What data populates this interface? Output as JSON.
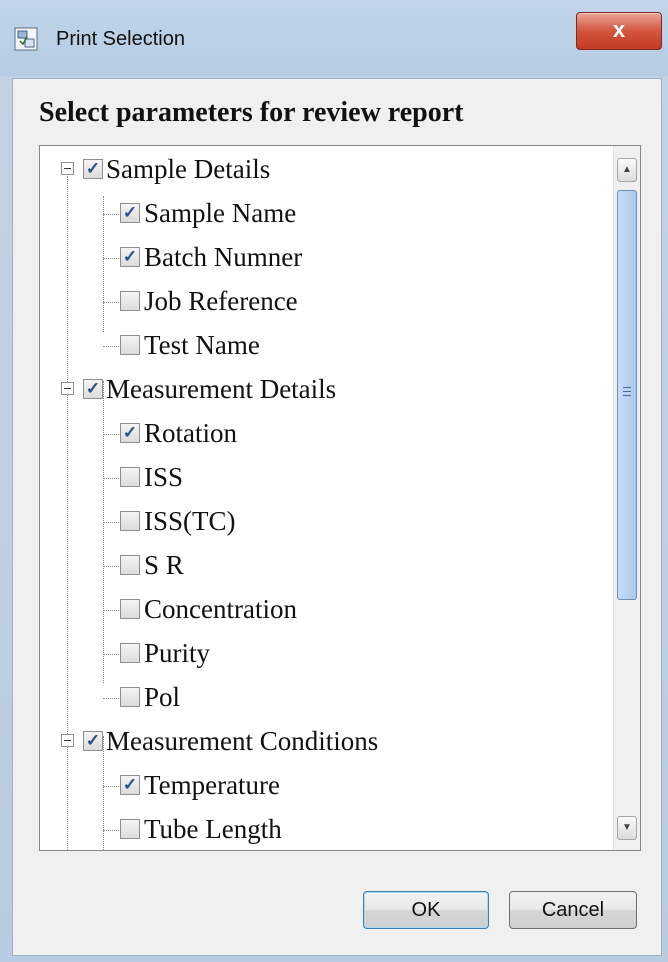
{
  "window": {
    "title": "Print Selection",
    "close_label": "x"
  },
  "dialog": {
    "heading": "Select parameters for review report"
  },
  "tree": {
    "groups": [
      {
        "label": "Sample Details",
        "checked": true,
        "items": [
          {
            "label": "Sample Name",
            "checked": true
          },
          {
            "label": "Batch Numner",
            "checked": true
          },
          {
            "label": "Job Reference",
            "checked": false
          },
          {
            "label": "Test Name",
            "checked": false
          }
        ]
      },
      {
        "label": "Measurement Details",
        "checked": true,
        "items": [
          {
            "label": "Rotation",
            "checked": true
          },
          {
            "label": "ISS",
            "checked": false
          },
          {
            "label": "ISS(TC)",
            "checked": false
          },
          {
            "label": "S R",
            "checked": false
          },
          {
            "label": "Concentration",
            "checked": false
          },
          {
            "label": "Purity",
            "checked": false
          },
          {
            "label": "Pol",
            "checked": false
          }
        ]
      },
      {
        "label": "Measurement Conditions",
        "checked": true,
        "items": [
          {
            "label": "Temperature",
            "checked": true
          },
          {
            "label": "Tube Length",
            "checked": false
          }
        ]
      }
    ]
  },
  "buttons": {
    "ok": "OK",
    "cancel": "Cancel"
  }
}
